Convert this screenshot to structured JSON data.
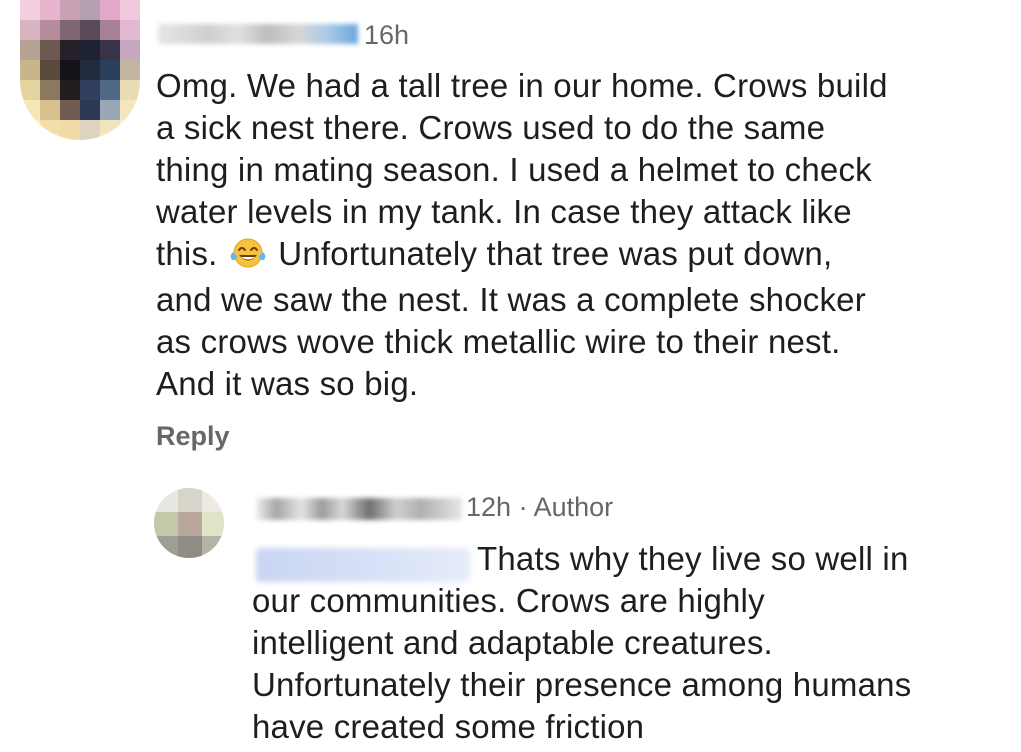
{
  "comment": {
    "time": "16h",
    "text": "Omg. We had a tall tree in our home. Crows build\na sick nest there. Crows used to do the same\nthing in mating season. I used a helmet to check\nwater levels in my tank. In case they attack like\nthis.",
    "emoji": "face-with-tears-of-joy",
    "text_after_emoji": "Unfortunately that tree was put down,\nand we saw the nest. It was a complete shocker\nas crows wove thick metallic wire to their nest.\nAnd it was so big.",
    "reply_label": "Reply"
  },
  "reply": {
    "time": "12h",
    "separator": "·",
    "author_badge": "Author",
    "text_first_line": "Thats why they live so well in",
    "text_rest": "our communities. Crows are highly\nintelligent and adaptable creatures.\nUnfortunately their presence among humans\nhave created some friction"
  },
  "colors": {
    "text": "#1c1e21",
    "meta": "#65676b",
    "mention_highlight": "#d7e0f6"
  }
}
